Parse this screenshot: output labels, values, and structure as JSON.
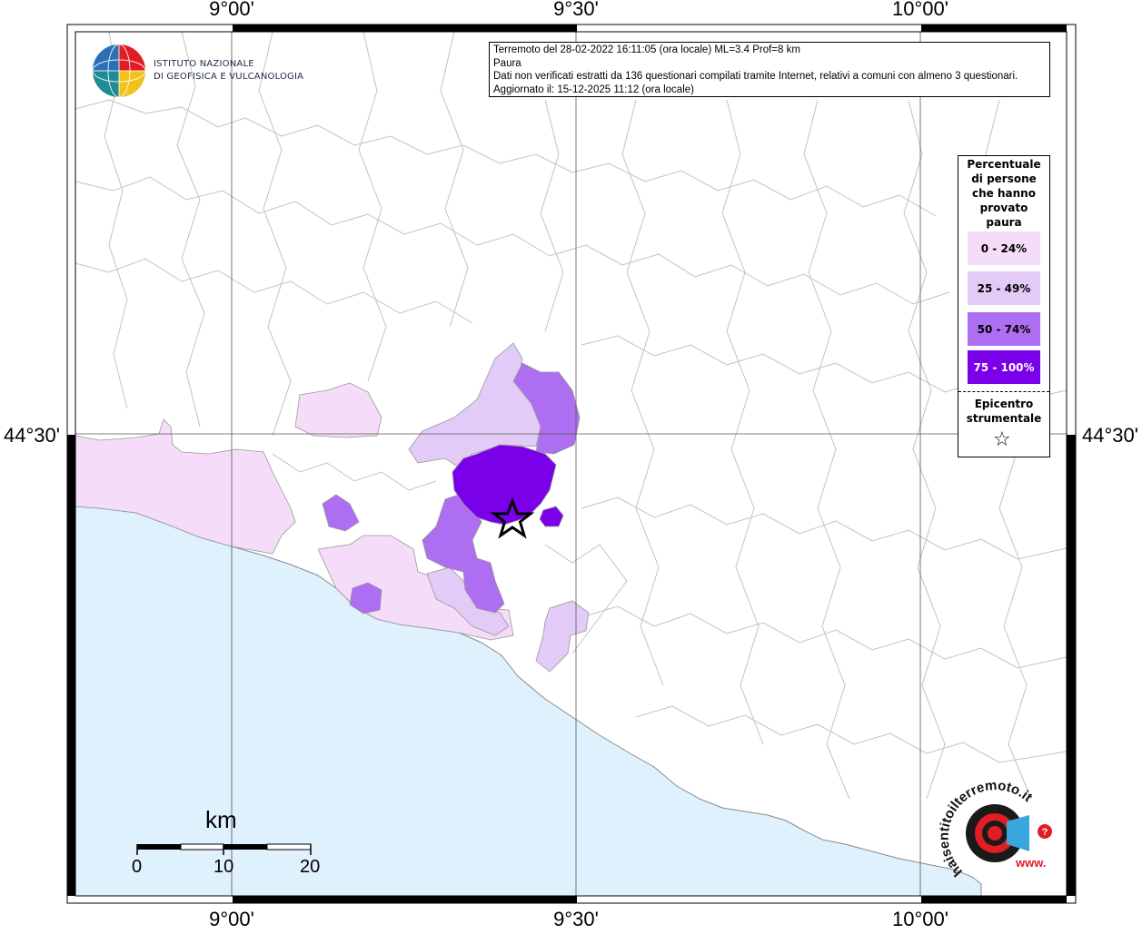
{
  "header": {
    "line1": "Terremoto del 28-02-2022 16:11:05 (ora locale) ML=3.4 Prof=8 km",
    "line2": "Paura",
    "line3": "Dati non verificati estratti da 136 questionari compilati tramite Internet, relativi a comuni con almeno 3 questionari.",
    "line4": "Aggiornato il: 15-12-2025 11:12 (ora locale)"
  },
  "logo": {
    "line1": "ISTITUTO NAZIONALE",
    "line2": "DI GEOFISICA E VULCANOLOGIA"
  },
  "axis_labels": {
    "top": [
      "9°00'",
      "9°30'",
      "10°00'"
    ],
    "bottom": [
      "9°00'",
      "9°30'",
      "10°00'"
    ],
    "left": "44°30'",
    "right": "44°30'"
  },
  "legend": {
    "title_lines": [
      "Percentuale",
      "di persone",
      "che hanno",
      "provato",
      "paura"
    ],
    "classes": [
      {
        "label": "0 - 24%",
        "color": "#f5dcf8"
      },
      {
        "label": "25 - 49%",
        "color": "#e2cbf7"
      },
      {
        "label": "50 - 74%",
        "color": "#ad6ef2"
      },
      {
        "label": "75 - 100%",
        "color": "#7a00ea"
      }
    ],
    "epicenter_lines": [
      "Epicentro",
      "strumentale"
    ],
    "epicenter_symbol": "☆"
  },
  "scale_bar": {
    "unit": "km",
    "ticks": [
      "0",
      "10",
      "20"
    ]
  },
  "watermark": {
    "text": "haisentitoilterremoto.it",
    "url_fragment": "www."
  },
  "colors": {
    "sea": "#dff1fc",
    "land": "#ffffff",
    "borders": "#b9b9b9",
    "grid": "#555555",
    "frame": "#000000"
  }
}
